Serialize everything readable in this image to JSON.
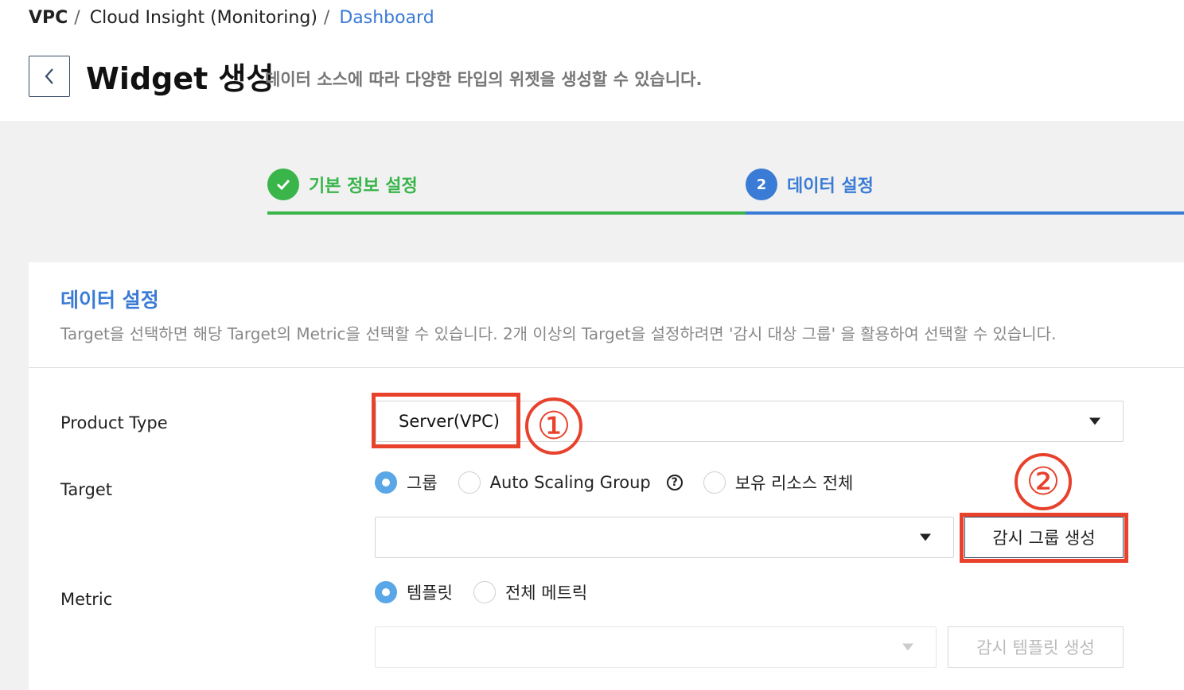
{
  "breadcrumb": {
    "items": [
      "VPC",
      "Cloud Insight (Monitoring)",
      "Dashboard"
    ],
    "separator": "/"
  },
  "header": {
    "title": "Widget 생성",
    "description": "데이터 소스에 따라 다양한 타입의 위젯을 생성할 수 있습니다."
  },
  "stepper": {
    "steps": [
      {
        "number": "1",
        "label": "기본 정보 설정",
        "status": "complete",
        "color": "#39b54a"
      },
      {
        "number": "2",
        "label": "데이터 설정",
        "status": "current",
        "color": "#3a7bd5"
      }
    ]
  },
  "card": {
    "title": "데이터 설정",
    "description": "Target을 선택하면 해당 Target의 Metric을 선택할 수 있습니다. 2개 이상의 Target을 설정하려면 '감시 대상 그룹' 을 활용하여 선택할 수 있습니다."
  },
  "form": {
    "product_type": {
      "label": "Product Type",
      "value": "Server(VPC)"
    },
    "target": {
      "label": "Target",
      "options": [
        "그룹",
        "Auto Scaling Group",
        "보유 리소스 전체"
      ],
      "selected": "그룹",
      "select_value": "",
      "create_button": "감시 그룹 생성"
    },
    "metric": {
      "label": "Metric",
      "options": [
        "템플릿",
        "전체 메트릭"
      ],
      "selected": "템플릿",
      "select_value": "",
      "create_button": "감시 템플릿 생성"
    }
  },
  "annotations": {
    "marker1": "①",
    "marker2": "②",
    "color": "#e8412c"
  },
  "icons": {
    "back": "chevron-left-icon",
    "check": "check-icon",
    "caret": "caret-down-icon",
    "help": "help-icon"
  },
  "help_glyph": "?"
}
